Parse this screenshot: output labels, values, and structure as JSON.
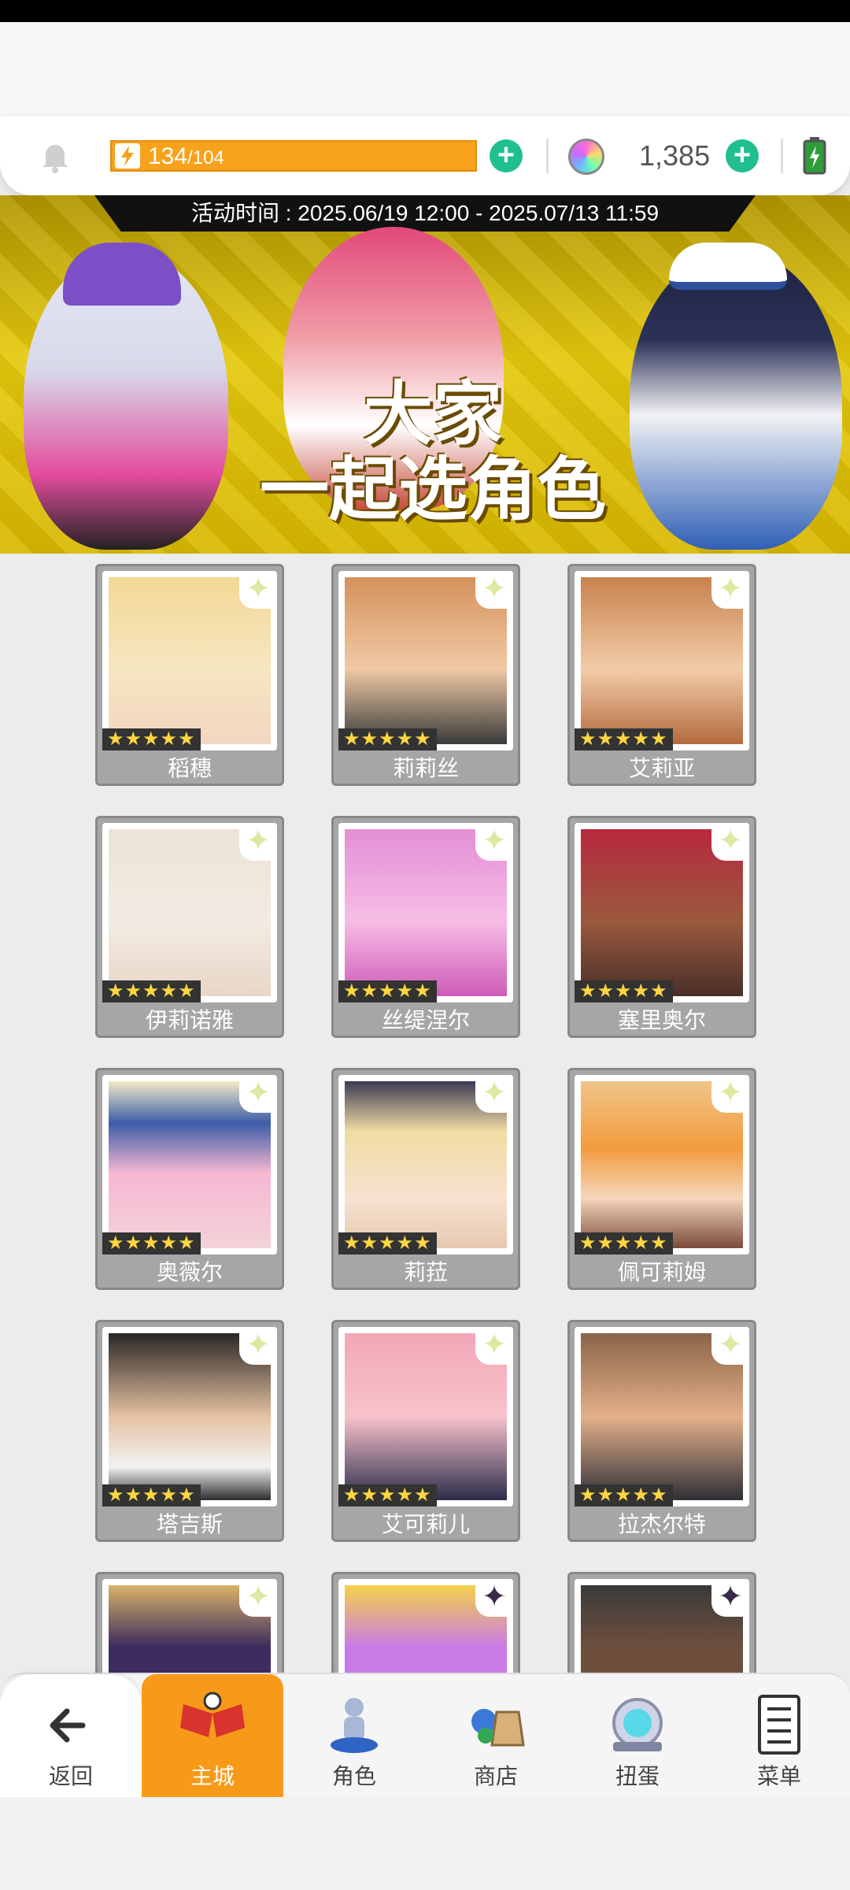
{
  "resources": {
    "energy_current": "134",
    "energy_max": "/104",
    "gems": "1,385",
    "colors": {
      "energy": "#f7a21b",
      "plus": "#1fbf8f"
    }
  },
  "event": {
    "time_label": "活动时间 : 2025.06/19 12:00 - 2025.07/13 11:59",
    "title_line1": "大家",
    "title_line2": "一起选角色"
  },
  "characters": [
    {
      "name": "稻穗",
      "stars": "★★★★★"
    },
    {
      "name": "莉莉丝",
      "stars": "★★★★★"
    },
    {
      "name": "艾莉亚",
      "stars": "★★★★★"
    },
    {
      "name": "伊莉诺雅",
      "stars": "★★★★★"
    },
    {
      "name": "丝缇涅尔",
      "stars": "★★★★★"
    },
    {
      "name": "塞里奥尔",
      "stars": "★★★★★"
    },
    {
      "name": "奥薇尔",
      "stars": "★★★★★"
    },
    {
      "name": "莉菈",
      "stars": "★★★★★"
    },
    {
      "name": "佩可莉姆",
      "stars": "★★★★★"
    },
    {
      "name": "塔吉斯",
      "stars": "★★★★★"
    },
    {
      "name": "艾可莉儿",
      "stars": "★★★★★"
    },
    {
      "name": "拉杰尔特",
      "stars": "★★★★★"
    }
  ],
  "nav": {
    "back": "返回",
    "main_city": "主城",
    "character": "角色",
    "shop": "商店",
    "gacha": "扭蛋",
    "menu": "菜单"
  },
  "icons": {
    "bell": "bell-icon",
    "energy": "lightning-icon",
    "gem": "rainbow-gem-icon",
    "battery": "battery-icon"
  }
}
